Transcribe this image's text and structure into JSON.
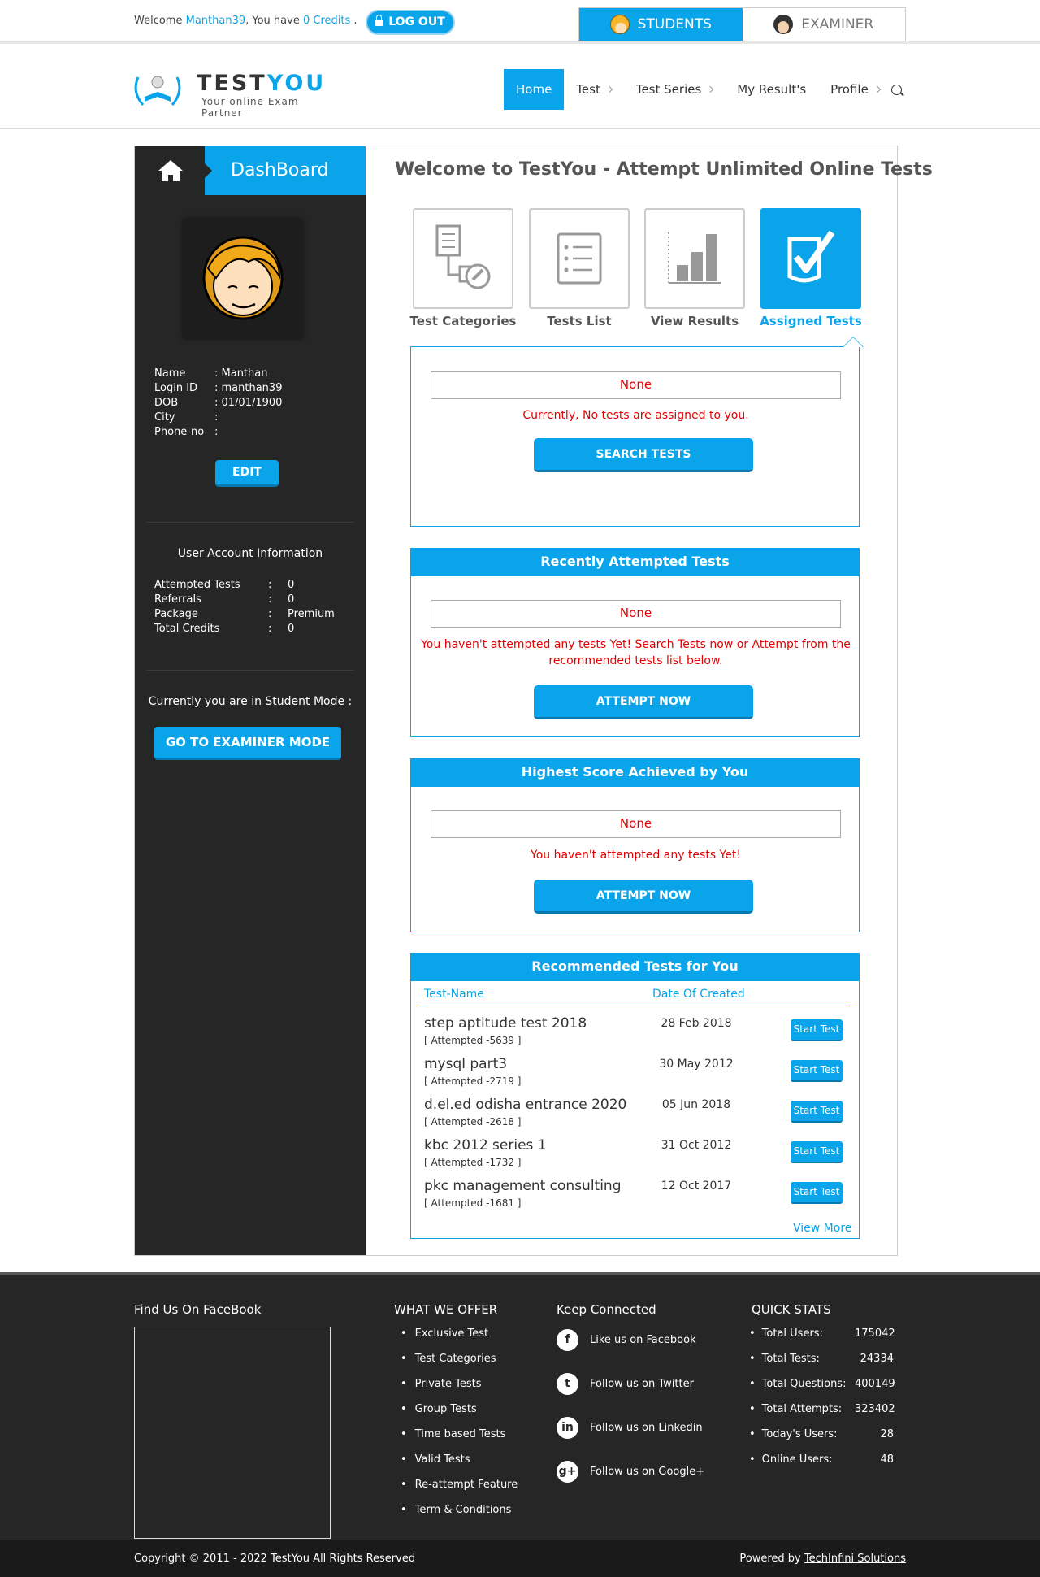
{
  "topbar": {
    "welcome_prefix": "Welcome",
    "username": "Manthan39",
    "you_have": ", You have",
    "credits": "0 Credits",
    "credits_suffix": ".",
    "logout_label": "LOG OUT",
    "mode_tabs": [
      {
        "label": "STUDENTS",
        "active": true
      },
      {
        "label": "EXAMINER",
        "active": false
      }
    ]
  },
  "header": {
    "logo_test": "TEST",
    "logo_you": "YOU",
    "logo_tagline": "Your online Exam Partner",
    "nav": [
      {
        "label": "Home",
        "active": true,
        "chevron": false
      },
      {
        "label": "Test",
        "chevron": true
      },
      {
        "label": "Test Series",
        "chevron": true
      },
      {
        "label": "My Result's",
        "chevron": false
      },
      {
        "label": "Profile",
        "chevron": true
      }
    ]
  },
  "sidebar": {
    "title": "DashBoard",
    "profile": [
      {
        "k": "Name",
        "v": ": Manthan"
      },
      {
        "k": "Login ID",
        "v": ": manthan39"
      },
      {
        "k": "DOB",
        "v": ": 01/01/1900"
      },
      {
        "k": "City",
        "v": ":"
      },
      {
        "k": "Phone-no",
        "v": ":"
      }
    ],
    "edit_label": "EDIT",
    "account_title": "User Account Information",
    "account": [
      {
        "k": "Attempted Tests",
        "c": ":",
        "v": "0"
      },
      {
        "k": "Referrals",
        "c": ":",
        "v": "0"
      },
      {
        "k": "Package",
        "c": ":",
        "v": "Premium"
      },
      {
        "k": "Total Credits",
        "c": ":",
        "v": "0"
      }
    ],
    "mode_text": "Currently you are in Student Mode :",
    "examiner_button": "GO TO EXAMINER MODE"
  },
  "main": {
    "title": "Welcome to TestYou - Attempt Unlimited Online Tests",
    "categories": [
      {
        "label": "Test Categories"
      },
      {
        "label": "Tests List"
      },
      {
        "label": "View Results"
      },
      {
        "label": "Assigned Tests",
        "active": true
      }
    ],
    "assigned": {
      "none": "None",
      "message": "Currently, No tests are assigned to you.",
      "button": "SEARCH TESTS"
    },
    "recent": {
      "title": "Recently Attempted Tests",
      "none": "None",
      "message": "You haven't attempted any tests Yet! Search Tests now or Attempt from the recommended tests list below.",
      "button": "ATTEMPT NOW"
    },
    "highest": {
      "title": "Highest Score Achieved by You",
      "none": "None",
      "message": "You haven't attempted any tests Yet!",
      "button": "ATTEMPT NOW"
    },
    "recommended": {
      "title": "Recommended Tests for You",
      "col_name": "Test-Name",
      "col_date": "Date Of Created",
      "rows": [
        {
          "name": "step aptitude test 2018",
          "attempted": "[ Attempted -5639 ]",
          "date": "28 Feb 2018",
          "button": "Start Test"
        },
        {
          "name": "mysql part3",
          "attempted": "[ Attempted -2719 ]",
          "date": "30 May 2012",
          "button": "Start Test"
        },
        {
          "name": "d.el.ed odisha entrance 2020",
          "attempted": "[ Attempted -2618 ]",
          "date": "05 Jun 2018",
          "button": "Start Test"
        },
        {
          "name": "kbc 2012 series 1",
          "attempted": "[ Attempted -1732 ]",
          "date": "31 Oct 2012",
          "button": "Start Test"
        },
        {
          "name": "pkc management consulting",
          "attempted": "[ Attempted -1681 ]",
          "date": "12 Oct 2017",
          "button": "Start Test"
        }
      ],
      "view_more": "View More"
    }
  },
  "footer": {
    "facebook_title": "Find Us On FaceBook",
    "offer_title": "WHAT WE OFFER",
    "offers": [
      "Exclusive Test",
      "Test Categories",
      "Private Tests",
      "Group Tests",
      "Time based Tests",
      "Valid Tests",
      "Re-attempt Feature",
      "Term & Conditions"
    ],
    "connect_title": "Keep Connected",
    "social": [
      {
        "icon": "facebook-icon",
        "glyph": "f",
        "label": "Like us on Facebook"
      },
      {
        "icon": "twitter-icon",
        "glyph": "t",
        "label": "Follow us on Twitter"
      },
      {
        "icon": "linkedin-icon",
        "glyph": "in",
        "label": "Follow us on Linkedin"
      },
      {
        "icon": "googleplus-icon",
        "glyph": "g+",
        "label": "Follow us on Google+"
      }
    ],
    "stats_title": "QUICK STATS",
    "stats": [
      {
        "k": "Total Users:",
        "v": "175042"
      },
      {
        "k": "Total Tests:",
        "v": "24334"
      },
      {
        "k": "Total Questions:",
        "v": "400149"
      },
      {
        "k": "Total Attempts:",
        "v": "323402"
      },
      {
        "k": "Today's Users:",
        "v": "28"
      },
      {
        "k": "Online Users:",
        "v": "48"
      }
    ],
    "copyright": "Copyright © 2011 - 2022  TestYou All Rights Reserved",
    "powered_prefix": "Powered by",
    "powered_by": "TechInfini Solutions"
  },
  "colors": {
    "accent": "#0aa4ea",
    "sidebar": "#262626",
    "error": "#e30000"
  }
}
